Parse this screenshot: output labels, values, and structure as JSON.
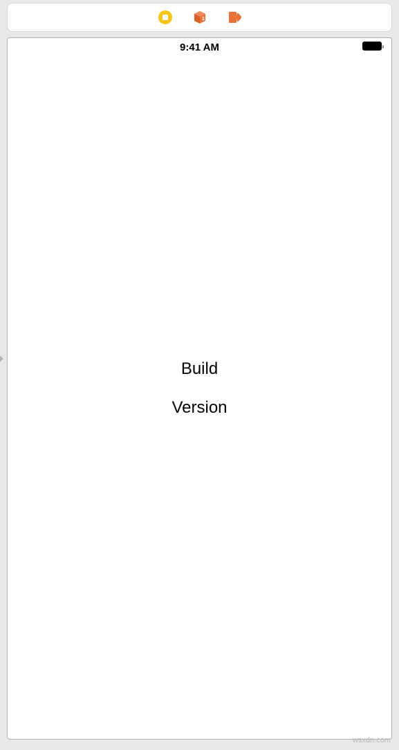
{
  "toolbar": {
    "stop_icon": "stop",
    "box_icon": "box",
    "exit_icon": "exit"
  },
  "status_bar": {
    "time": "9:41 AM"
  },
  "content": {
    "build_label": "Build",
    "version_label": "Version"
  },
  "watermark": "wsxdn.com",
  "colors": {
    "stop_yellow": "#f5c518",
    "box_orange": "#e8733a",
    "exit_orange": "#e8733a"
  }
}
